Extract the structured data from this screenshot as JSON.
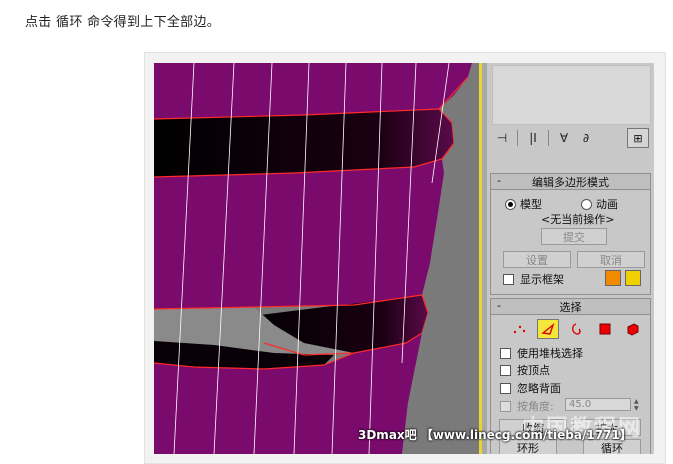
{
  "caption": "点击 循环 命令得到上下全部边。",
  "panel": {
    "edit_poly_mode": {
      "title": "编辑多边形模式",
      "radio_model": "模型",
      "radio_anim": "动画",
      "no_op": "<无当前操作>",
      "commit": "提交",
      "settings": "设置",
      "cancel": "取消",
      "show_cage": "显示框架",
      "cage_color_1": "#f08a00",
      "cage_color_2": "#f0d000"
    },
    "selection": {
      "title": "选择",
      "use_stack": "使用堆栈选择",
      "by_vertex": "按顶点",
      "ignore_back": "忽略背面",
      "by_angle": "按角度:",
      "angle_value": "45.0",
      "shrink": "收缩",
      "grow": "扩大",
      "ring": "环形",
      "loop": "循环"
    }
  },
  "watermark": {
    "text": "3Dmax吧 【www.linecg.com/tieba/1771】",
    "big": "中国教程网"
  }
}
